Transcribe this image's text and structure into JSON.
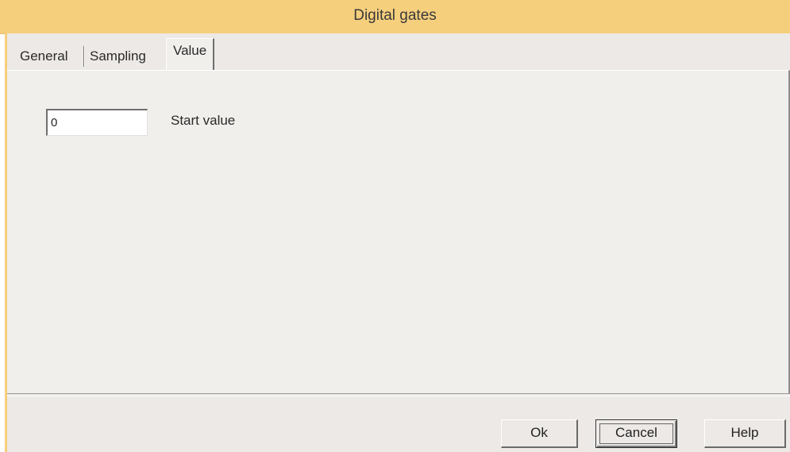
{
  "window": {
    "title": "Digital gates"
  },
  "tabs": [
    {
      "label": "General"
    },
    {
      "label": "Sampling"
    },
    {
      "label": "Value"
    }
  ],
  "active_tab": "Value",
  "value_panel": {
    "start_value": "0",
    "start_value_label": "Start value"
  },
  "buttons": {
    "ok": "Ok",
    "cancel": "Cancel",
    "help": "Help"
  },
  "colors": {
    "titlebar": "#f6cf7d",
    "dialog_face": "#ece9e6"
  }
}
